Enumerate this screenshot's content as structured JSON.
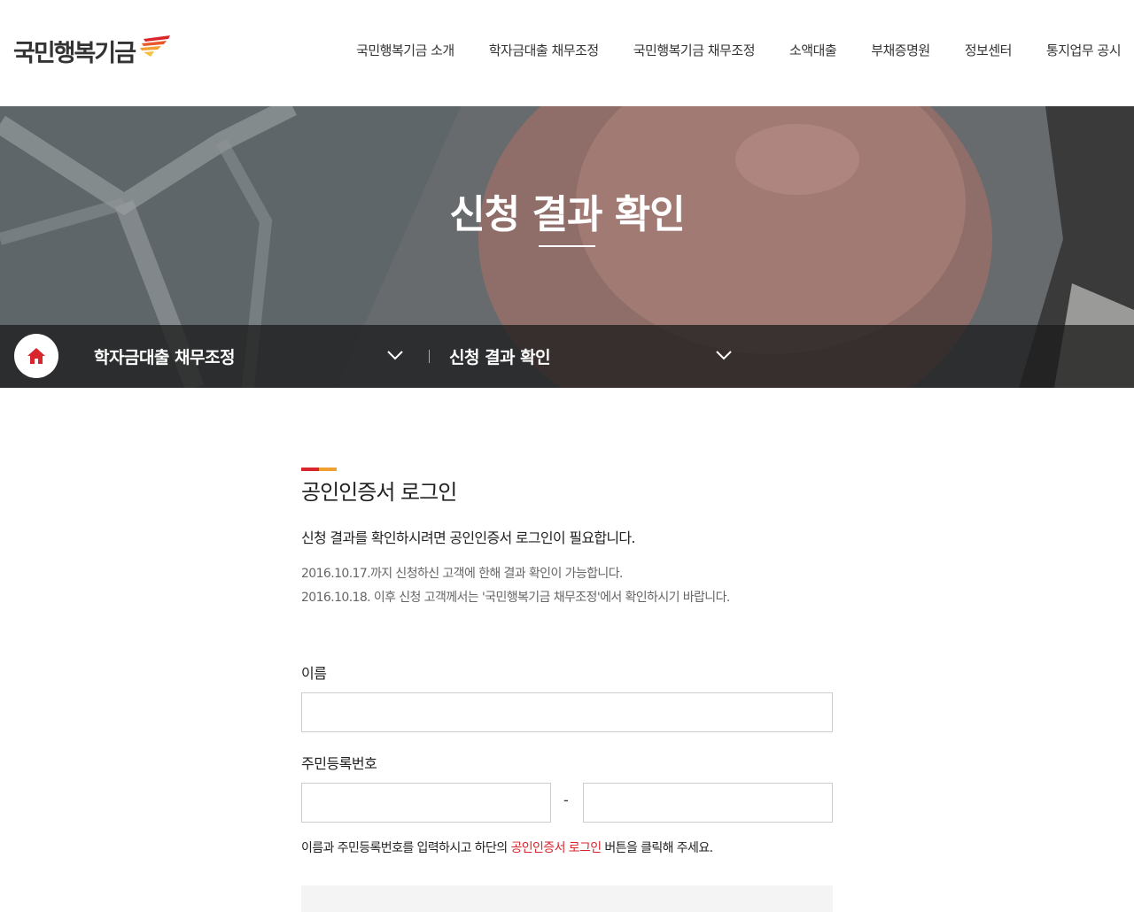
{
  "header": {
    "logo_text": "국민행복기금",
    "nav": [
      "국민행복기금 소개",
      "학자금대출 채무조정",
      "국민행복기금 채무조정",
      "소액대출",
      "부채증명원",
      "정보센터",
      "통지업무 공시"
    ]
  },
  "hero": {
    "title": "신청 결과 확인",
    "breadcrumb": {
      "home_icon": "home-icon",
      "level1": "학자금대출 채무조정",
      "level2": "신청 결과 확인"
    }
  },
  "main": {
    "section_title": "공인인증서 로그인",
    "lead": "신청 결과를 확인하시려면 공인인증서 로그인이 필요합니다.",
    "notes": [
      "2016.10.17.까지 신청하신 고객에 한해 결과 확인이 가능합니다.",
      "2016.10.18. 이후 신청 고객께서는 '국민행복기금 채무조정'에서 확인하시기 바랍니다."
    ],
    "form": {
      "name_label": "이름",
      "name_value": "",
      "rrn_label": "주민등록번호",
      "rrn_front_value": "",
      "rrn_back_value": "",
      "rrn_separator": "-",
      "help_prefix": "이름과 주민등록번호를 입력하시고 하단의 ",
      "help_highlight": "공인인증서 로그인",
      "help_suffix": " 버튼을 클릭해 주세요."
    }
  },
  "colors": {
    "accent_red": "#d9262c",
    "accent_orange": "#f0a030",
    "subnav_bg": "#1e1e1e"
  }
}
